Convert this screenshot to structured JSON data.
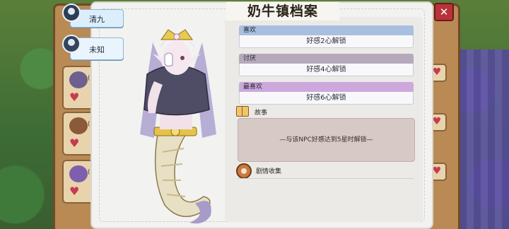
{
  "title": "奶牛镇档案",
  "close_glyph": "✕",
  "npc_tabs": [
    {
      "label": "清九"
    },
    {
      "label": "未知"
    }
  ],
  "preferences": [
    {
      "head": "喜欢",
      "body": "好感2心解锁"
    },
    {
      "head": "讨厌",
      "body": "好感4心解锁"
    },
    {
      "head": "最喜欢",
      "body": "好感6心解锁"
    }
  ],
  "story": {
    "label": "故事",
    "text": "—与该NPC好感达到5星时解锁—"
  },
  "plot": {
    "label": "剧情收集"
  },
  "background_rows": [
    {
      "text": "(同"
    },
    {
      "text": "(亲"
    },
    {
      "text": "(亲"
    }
  ],
  "colors": {
    "like": "#a9bfe0",
    "dislike": "#b5a9bb",
    "favorite": "#cda8dc",
    "story_box": "#d6c9c6",
    "tab": "#dceefc"
  },
  "icons": [
    "person-icon",
    "heart-icon",
    "story-book-icon",
    "plot-reel-icon",
    "close-icon"
  ]
}
